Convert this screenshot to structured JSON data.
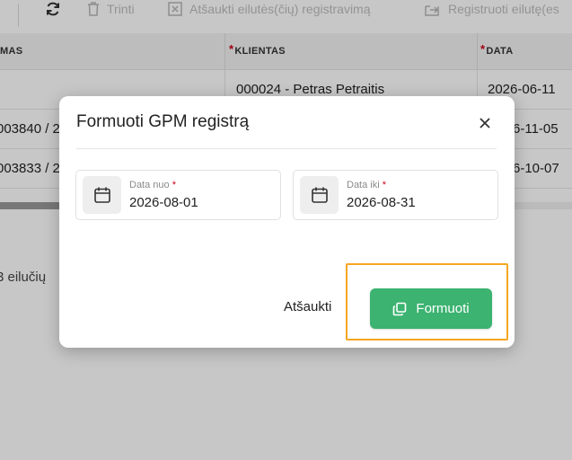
{
  "toolbar": {
    "refresh_icon": "refresh-icon",
    "delete_label": "Trinti",
    "cancel_registration_label": "Atšaukti eilutės(čių) registravimą",
    "register_label": "Registruoti eilutę(es"
  },
  "grid": {
    "columns": [
      {
        "label": "MAS",
        "required": false
      },
      {
        "label": "KLIENTAS",
        "required": true
      },
      {
        "label": "DATA",
        "required": true
      }
    ],
    "rows": [
      {
        "col1": "",
        "client": "000024 - Petras Petraitis",
        "date": "2026-06-11"
      },
      {
        "col1": "003840 / 2",
        "client": "",
        "date": "6-11-05"
      },
      {
        "col1": "003833 / 2",
        "client": "",
        "date": "6-10-07"
      }
    ],
    "row_count_text": "3 eilučių"
  },
  "modal": {
    "title": "Formuoti GPM registrą",
    "date_from": {
      "label": "Data nuo",
      "required_mark": "*",
      "value": "2026-08-01"
    },
    "date_to": {
      "label": "Data iki",
      "required_mark": "*",
      "value": "2026-08-31"
    },
    "cancel_label": "Atšaukti",
    "submit_label": "Formuoti"
  },
  "colors": {
    "primary": "#3cb371",
    "focus": "#f5a623",
    "required": "#d0021b"
  }
}
